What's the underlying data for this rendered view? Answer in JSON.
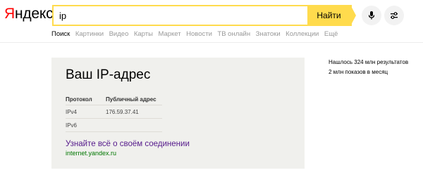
{
  "logo": {
    "first": "Я",
    "rest": "ндекс"
  },
  "search": {
    "value": "ip",
    "button_label": "Найти",
    "clear_glyph": "✕"
  },
  "icons": {
    "mic": "microphone-icon",
    "filters": "filter-sliders-icon"
  },
  "nav": {
    "items": [
      {
        "label": "Поиск"
      },
      {
        "label": "Картинки"
      },
      {
        "label": "Видео"
      },
      {
        "label": "Карты"
      },
      {
        "label": "Маркет"
      },
      {
        "label": "Новости"
      },
      {
        "label": "ТВ онлайн"
      },
      {
        "label": "Знатоки"
      },
      {
        "label": "Коллекции"
      },
      {
        "label": "Ещё"
      }
    ],
    "active_index": 0
  },
  "ip_card": {
    "title": "Ваш IP-адрес",
    "columns": [
      "Протокол",
      "Публичный адрес"
    ],
    "rows": [
      {
        "protocol": "IPv4",
        "address": "176.59.37.41"
      },
      {
        "protocol": "IPv6",
        "address": ""
      }
    ],
    "more_link": "Узнайте всё о своём соединении",
    "domain": "internet.yandex.ru"
  },
  "results": {
    "count": "Нашлось 324 млн результатов",
    "shows": "2 млн показов в месяц"
  },
  "colors": {
    "brand_red": "#ff0000",
    "search_yellow": "#ffdb4d",
    "link_purple": "#551a8b",
    "domain_green": "#007700",
    "card_bg": "#f0f0ed"
  }
}
